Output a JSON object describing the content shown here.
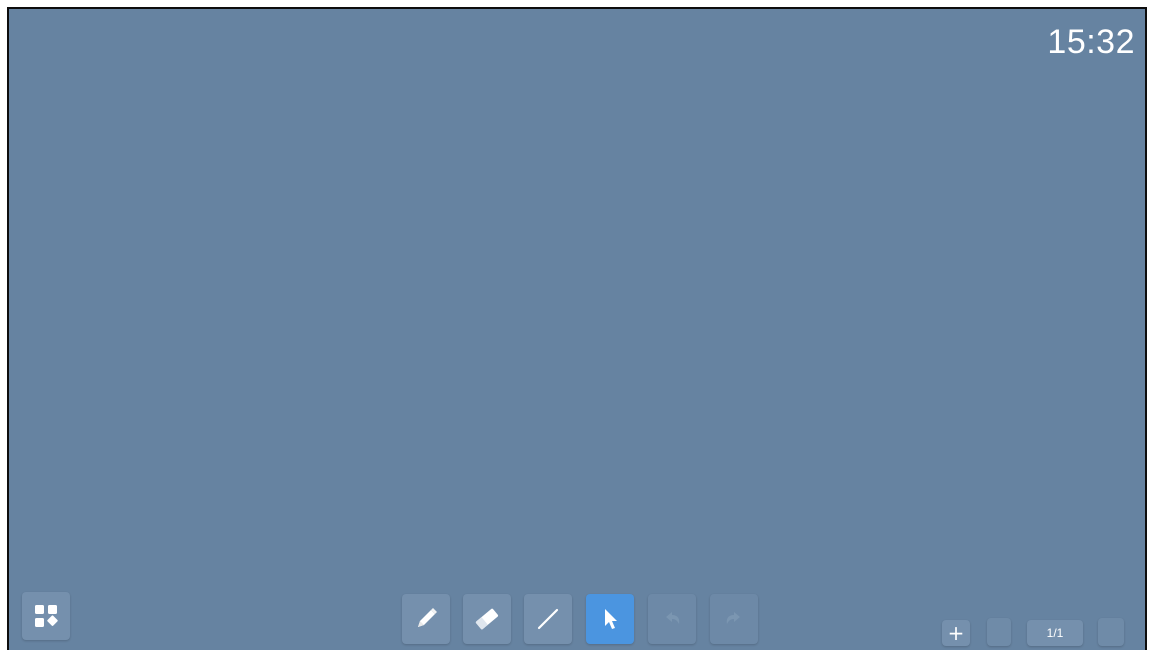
{
  "clock": {
    "time": "15:32"
  },
  "toolbar": {
    "tools": [
      {
        "name": "pen",
        "icon": "pencil-icon"
      },
      {
        "name": "eraser",
        "icon": "eraser-icon"
      },
      {
        "name": "line",
        "icon": "line-icon"
      },
      {
        "name": "select",
        "icon": "cursor-icon",
        "active": true
      },
      {
        "name": "undo",
        "icon": "undo-icon",
        "enabled": false
      },
      {
        "name": "redo",
        "icon": "redo-icon",
        "enabled": false
      }
    ]
  },
  "apps": {
    "icon": "apps-grid-icon"
  },
  "pagination": {
    "add_label": "+",
    "indicator": "1/1"
  },
  "colors": {
    "canvas": "#6683a1",
    "active_tool": "#4b95e0",
    "text": "#ffffff"
  }
}
